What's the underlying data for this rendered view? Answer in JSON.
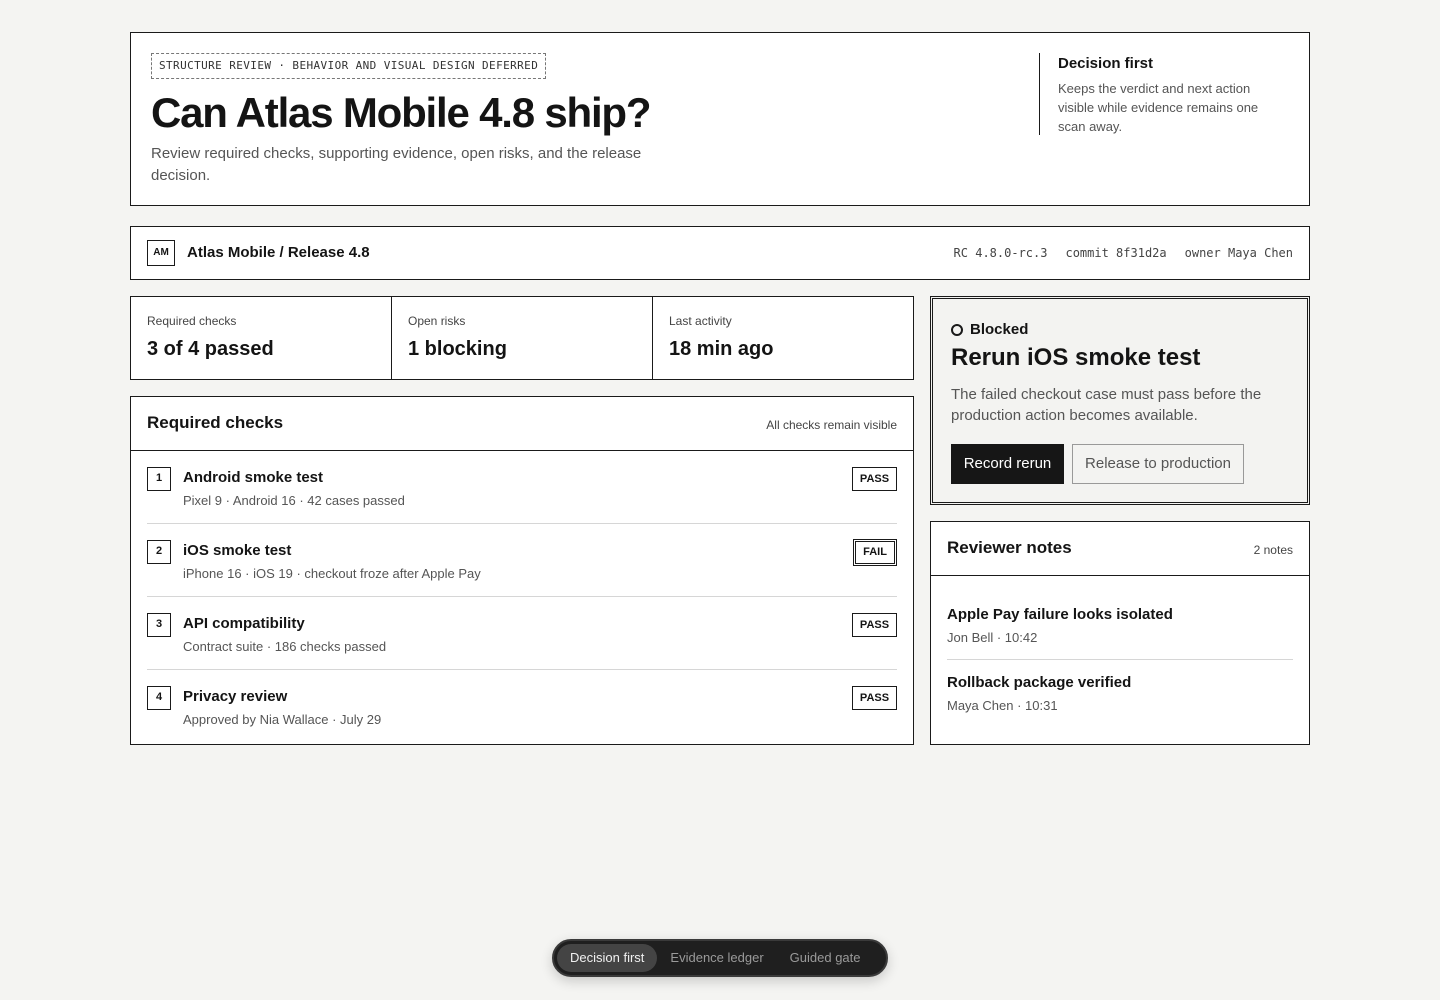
{
  "hero": {
    "tag": "STRUCTURE REVIEW · BEHAVIOR AND VISUAL DESIGN DEFERRED",
    "title": "Can Atlas Mobile 4.8 ship?",
    "subtitle": "Review required checks, supporting evidence, open risks, and the release decision.",
    "aside_title": "Decision first",
    "aside_text": "Keeps the verdict and next action visible while evidence remains one scan away."
  },
  "project": {
    "avatar": "AM",
    "name": "Atlas Mobile / Release 4.8",
    "rc": "RC 4.8.0-rc.3",
    "commit": "commit 8f31d2a",
    "owner": "owner Maya Chen"
  },
  "stats": [
    {
      "label": "Required checks",
      "value": "3 of 4 passed"
    },
    {
      "label": "Open risks",
      "value": "1 blocking"
    },
    {
      "label": "Last activity",
      "value": "18 min ago"
    }
  ],
  "checks": {
    "title": "Required checks",
    "note": "All checks remain visible",
    "items": [
      {
        "num": "1",
        "title": "Android smoke test",
        "detail": "Pixel 9 · Android 16 · 42 cases passed",
        "status": "PASS"
      },
      {
        "num": "2",
        "title": "iOS smoke test",
        "detail": "iPhone 16 · iOS 19 · checkout froze after Apple Pay",
        "status": "FAIL"
      },
      {
        "num": "3",
        "title": "API compatibility",
        "detail": "Contract suite · 186 checks passed",
        "status": "PASS"
      },
      {
        "num": "4",
        "title": "Privacy review",
        "detail": "Approved by Nia Wallace · July 29",
        "status": "PASS"
      }
    ]
  },
  "decision": {
    "status": "Blocked",
    "title": "Rerun iOS smoke test",
    "text": "The failed checkout case must pass before the production action becomes available.",
    "primary_label": "Record rerun",
    "secondary_label": "Release to production"
  },
  "notes": {
    "title": "Reviewer notes",
    "count": "2 notes",
    "items": [
      {
        "title": "Apple Pay failure looks isolated",
        "meta": "Jon Bell · 10:42"
      },
      {
        "title": "Rollback package verified",
        "meta": "Maya Chen · 10:31"
      }
    ]
  },
  "switcher": {
    "options": [
      "Decision first",
      "Evidence ledger",
      "Guided gate"
    ],
    "active": "Decision first"
  }
}
